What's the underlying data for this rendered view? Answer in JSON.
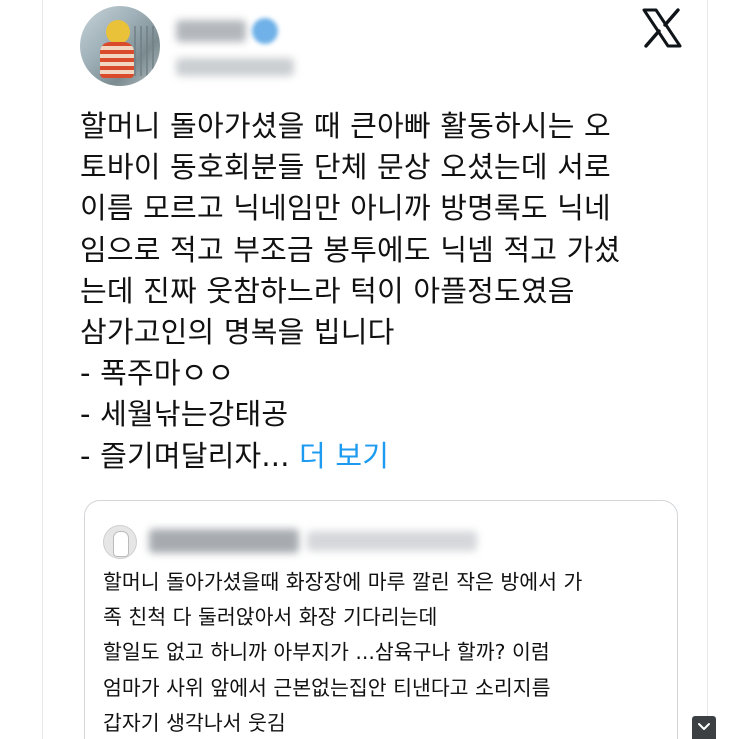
{
  "header": {
    "close_icon": "x-logo-icon"
  },
  "tweet": {
    "lines": [
      "할머니 돌아가셨을 때 큰아빠 활동하시는 오",
      "토바이 동호회분들 단체 문상 오셨는데 서로",
      "이름 모르고 닉네임만 아니까 방명록도 닉네",
      "임으로 적고 부조금 봉투에도 닉넴 적고 가셨",
      "는데 진짜 웃참하느라 턱이 아플정도였음",
      "삼가고인의 명복을 빕니다",
      "- 폭주마ㅇㅇ",
      "- 세월낚는강태공",
      "- 즐기며달리자..."
    ],
    "more_label": "더 보기"
  },
  "quote": {
    "lines": [
      "할머니 돌아가셨을때 화장장에 마루 깔린 작은 방에서 가",
      "족 친척 다 둘러앉아서 화장 기다리는데",
      "할일도 없고 하니까 아부지가 ...삼육구나 할까? 이럼",
      "엄마가 사위 앞에서 근본없는집안 티낸다고 소리지름",
      "갑자기 생각나서 웃김"
    ]
  },
  "colors": {
    "accent": "#1d9bf0",
    "text": "#0f1419",
    "border": "#d2d6d9"
  }
}
